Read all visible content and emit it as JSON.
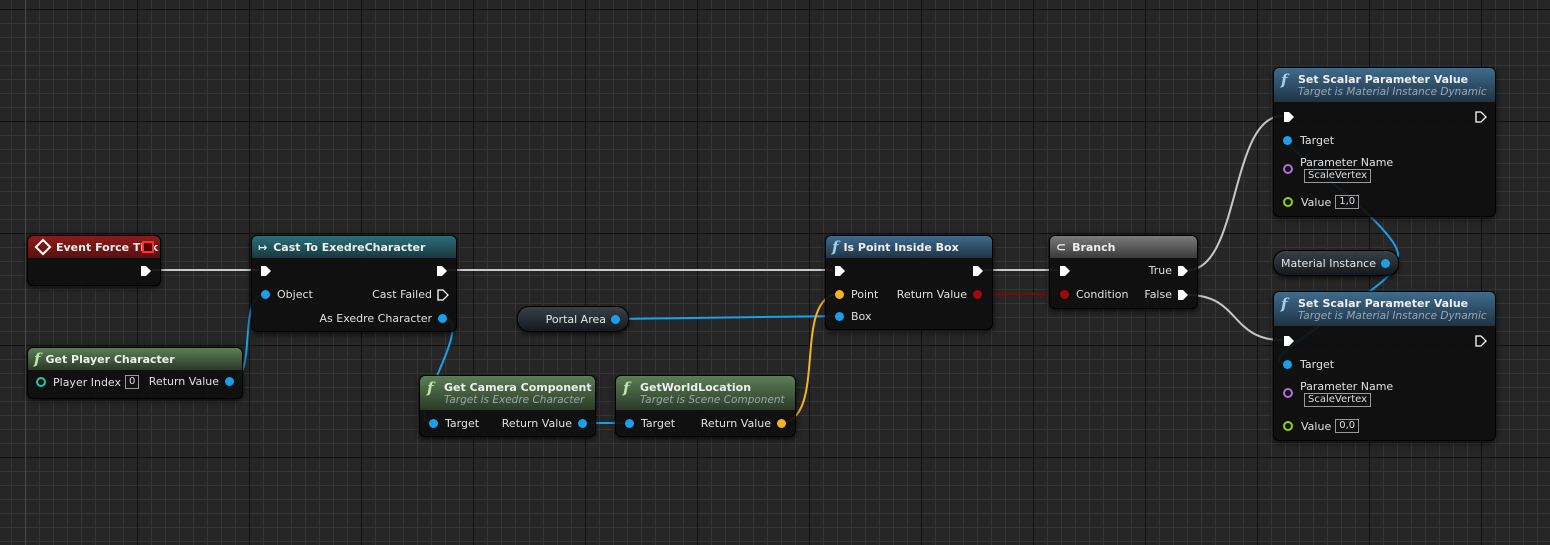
{
  "graph": {
    "colors": {
      "exec_wire": "#c8c8c8",
      "object_wire": "#18a0ea",
      "vector_wire": "#f3b51c",
      "bool_wire": "#7a0a0a",
      "event_header": "#8c1c1c",
      "pure_function_header": "#5b7e55",
      "function_header": "#3f6b8c",
      "cast_header": "#2c6f78",
      "branch_header": "#7a7a7a"
    },
    "nodes": {
      "event_force_tick": {
        "title": "Event Force Tick",
        "icon": "event-diamond-icon"
      },
      "get_player_character": {
        "title": "Get Player Character",
        "icon": "function-icon",
        "player_index_label": "Player Index",
        "player_index_value": "0",
        "return_label": "Return Value"
      },
      "cast": {
        "title": "Cast To ExedreCharacter",
        "icon": "cast-arrow-icon",
        "object_label": "Object",
        "cast_failed_label": "Cast Failed",
        "as_label": "As Exedre Character"
      },
      "get_camera": {
        "title": "Get Camera Component",
        "subtitle": "Target is Exedre Character",
        "target_label": "Target",
        "return_label": "Return Value"
      },
      "get_world_location": {
        "title": "GetWorldLocation",
        "subtitle": "Target is Scene Component",
        "target_label": "Target",
        "return_label": "Return Value"
      },
      "portal_area": {
        "label": "Portal Area"
      },
      "is_point_inside_box": {
        "title": "Is Point Inside Box",
        "point_label": "Point",
        "box_label": "Box",
        "return_label": "Return Value"
      },
      "branch": {
        "title": "Branch",
        "condition_label": "Condition",
        "true_label": "True",
        "false_label": "False"
      },
      "material_instance": {
        "label": "Material Instance"
      },
      "set_scalar_1": {
        "title": "Set Scalar Parameter Value",
        "subtitle": "Target is Material Instance Dynamic",
        "target_label": "Target",
        "param_name_label": "Parameter Name",
        "param_name_value": "ScaleVertex",
        "value_label": "Value",
        "value_value": "1,0"
      },
      "set_scalar_2": {
        "title": "Set Scalar Parameter Value",
        "subtitle": "Target is Material Instance Dynamic",
        "target_label": "Target",
        "param_name_label": "Parameter Name",
        "param_name_value": "ScaleVertex",
        "value_label": "Value",
        "value_value": "0,0"
      }
    }
  }
}
